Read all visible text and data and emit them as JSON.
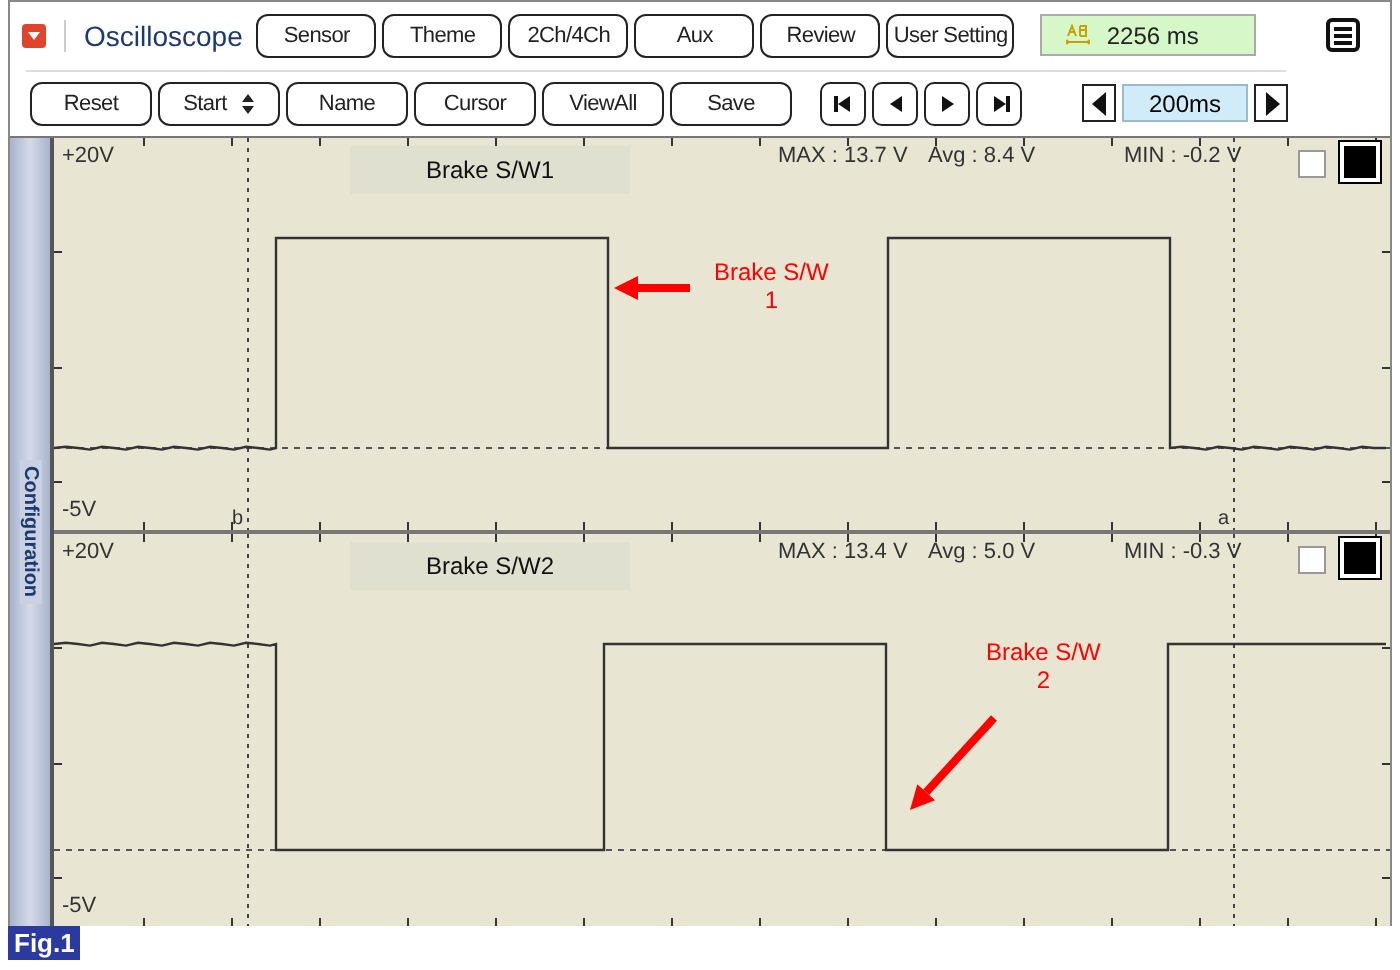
{
  "app": {
    "title": "Oscilloscope"
  },
  "top_buttons": [
    {
      "label": "Sensor"
    },
    {
      "label": "Theme"
    },
    {
      "label": "2Ch/4Ch"
    },
    {
      "label": "Aux"
    },
    {
      "label": "Review"
    },
    {
      "label": "User Setting"
    }
  ],
  "timer": {
    "reading": "2256 ms"
  },
  "controls": [
    {
      "kind": "button",
      "label": "Reset"
    },
    {
      "kind": "select",
      "label": "Start"
    },
    {
      "kind": "button",
      "label": "Name"
    },
    {
      "kind": "button",
      "label": "Cursor"
    },
    {
      "kind": "button",
      "label": "ViewAll"
    },
    {
      "kind": "button",
      "label": "Save"
    }
  ],
  "time_scale": {
    "value": "200ms"
  },
  "sidebar": {
    "label": "Configuration"
  },
  "channels": [
    {
      "title": "Brake S/W1",
      "max": "MAX : 13.7 V",
      "avg": "Avg : 8.4 V",
      "min": "MIN : -0.2 V",
      "top_label": "+20V",
      "bottom_label": "-5V",
      "cursor_labels": [
        "b",
        "a"
      ],
      "annotation": [
        "Brake S/W",
        "1"
      ]
    },
    {
      "title": "Brake S/W2",
      "max": "MAX : 13.4 V",
      "avg": "Avg : 5.0 V",
      "min": "MIN : -0.3 V",
      "top_label": "+20V",
      "bottom_label": "-5V",
      "annotation": [
        "Brake S/W",
        "2"
      ]
    }
  ],
  "figure_label": "Fig.1"
}
